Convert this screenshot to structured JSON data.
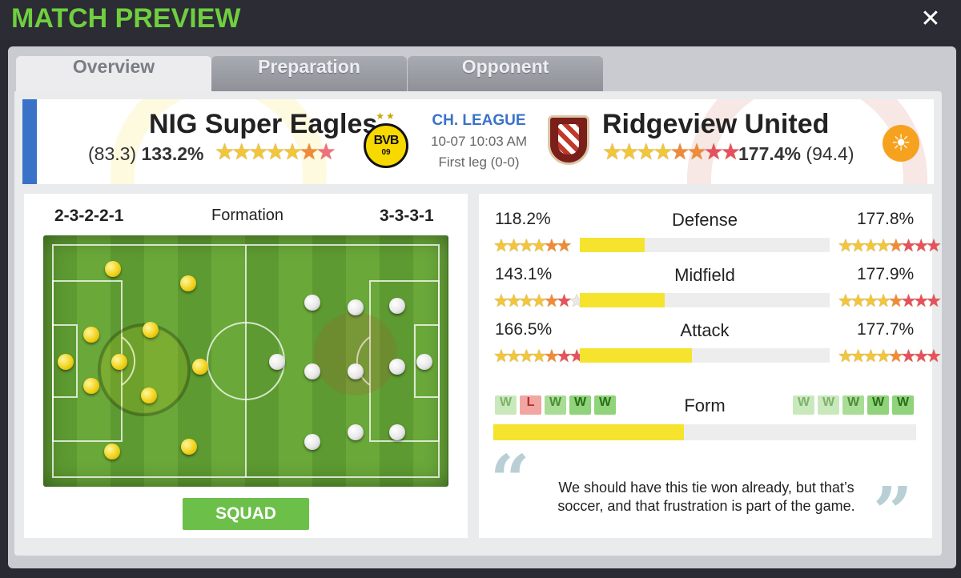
{
  "title": "MATCH PREVIEW",
  "close_label": "✕",
  "tabs": [
    {
      "label": "Overview",
      "active": true
    },
    {
      "label": "Preparation",
      "active": false
    },
    {
      "label": "Opponent",
      "active": false
    }
  ],
  "home": {
    "name": "NIG Super Eagles",
    "rating": "(83.3)",
    "strength": "133.2%",
    "stars": [
      "g",
      "g",
      "g",
      "g",
      "g",
      "o",
      "p"
    ],
    "badge_text": "BVB",
    "badge_sub": "09",
    "crown_stars": "★★",
    "formation": "2-3-2-2-1"
  },
  "away": {
    "name": "Ridgeview United",
    "rating": "(94.4)",
    "strength": "177.4%",
    "stars": [
      "g",
      "g",
      "g",
      "g",
      "o",
      "o",
      "r",
      "r"
    ],
    "formation": "3-3-3-1"
  },
  "match": {
    "competition": "CH. LEAGUE",
    "datetime": "10-07 10:03 AM",
    "leg": "First leg (0-0)",
    "weather": "☀"
  },
  "formation_label": "Formation",
  "squad_button": "SQUAD",
  "comparison": [
    {
      "label": "Defense",
      "home": "118.2%",
      "away": "177.8%",
      "home_fill": 0.26,
      "home_stars": [
        "g",
        "g",
        "g",
        "g",
        "o",
        "o"
      ],
      "away_stars": [
        "g",
        "g",
        "g",
        "g",
        "o",
        "r",
        "r",
        "r"
      ]
    },
    {
      "label": "Midfield",
      "home": "143.1%",
      "away": "177.9%",
      "home_fill": 0.34,
      "home_stars": [
        "g",
        "g",
        "g",
        "g",
        "o",
        "r",
        "w"
      ],
      "away_stars": [
        "g",
        "g",
        "g",
        "g",
        "o",
        "r",
        "r",
        "r"
      ]
    },
    {
      "label": "Attack",
      "home": "166.5%",
      "away": "177.7%",
      "home_fill": 0.45,
      "home_stars": [
        "g",
        "g",
        "g",
        "g",
        "o",
        "r",
        "r"
      ],
      "away_stars": [
        "g",
        "g",
        "g",
        "g",
        "o",
        "r",
        "r",
        "r"
      ]
    }
  ],
  "form": {
    "label": "Form",
    "home": [
      {
        "r": "W",
        "s": "Wl"
      },
      {
        "r": "L",
        "s": "L"
      },
      {
        "r": "W",
        "s": "Wm"
      },
      {
        "r": "W",
        "s": "W"
      },
      {
        "r": "W",
        "s": "W"
      }
    ],
    "away": [
      {
        "r": "W",
        "s": "Wl"
      },
      {
        "r": "W",
        "s": "Wl"
      },
      {
        "r": "W",
        "s": "Wm"
      },
      {
        "r": "W",
        "s": "W"
      },
      {
        "r": "W",
        "s": "W"
      }
    ],
    "home_fill": 0.45
  },
  "quote": {
    "open": "“",
    "close": "”",
    "text": "We should have this tie won already, but that’s soccer, and that frustration is part of the game."
  },
  "colors": {
    "title_green": "#6fcf3f",
    "accent_blue": "#3a72c8",
    "bar_yellow": "#f5e32e",
    "squad_green": "#6cc04a"
  }
}
